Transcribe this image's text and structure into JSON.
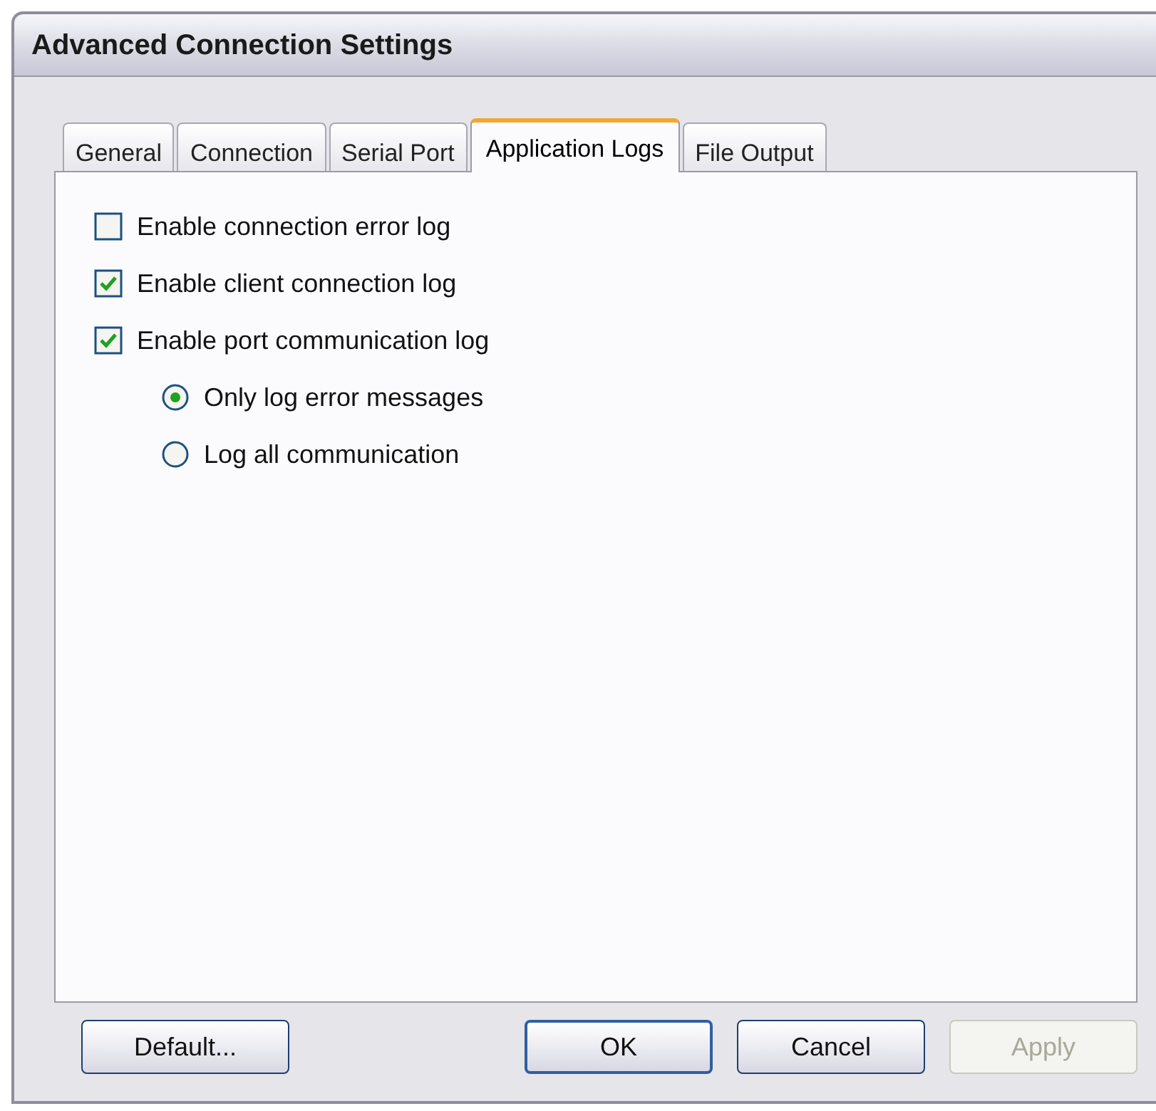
{
  "window": {
    "title": "Advanced Connection Settings"
  },
  "tabs": [
    {
      "label": "General",
      "selected": false
    },
    {
      "label": "Connection",
      "selected": false
    },
    {
      "label": "Serial Port",
      "selected": false
    },
    {
      "label": "Application Logs",
      "selected": true
    },
    {
      "label": "File Output",
      "selected": false
    }
  ],
  "options": [
    {
      "kind": "checkbox",
      "label": "Enable connection error log",
      "checked": false
    },
    {
      "kind": "checkbox",
      "label": "Enable client connection log",
      "checked": true
    },
    {
      "kind": "checkbox",
      "label": "Enable port communication log",
      "checked": true,
      "children": [
        {
          "kind": "radio",
          "label": "Only log error messages",
          "selected": true
        },
        {
          "kind": "radio",
          "label": "Log all communication",
          "selected": false
        }
      ]
    }
  ],
  "buttons": [
    {
      "label": "Default...",
      "disabled": false,
      "default": false
    },
    {
      "label": "OK",
      "disabled": false,
      "default": true
    },
    {
      "label": "Cancel",
      "disabled": false,
      "default": false
    },
    {
      "label": "Apply",
      "disabled": true,
      "default": false
    }
  ]
}
